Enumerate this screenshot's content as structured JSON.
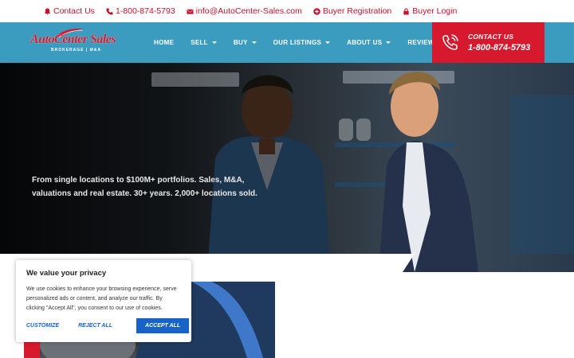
{
  "topbar": {
    "contact_label": "Contact Us",
    "phone": "1-800-874-5793",
    "email": "info@AutoCenter-Sales.com",
    "registration_label": "Buyer Registration",
    "login_label": "Buyer Login"
  },
  "logo": {
    "name": "AutoCenter Sales",
    "sub": "BROKERAGE | M&A"
  },
  "nav": {
    "items": [
      {
        "label": "HOME",
        "dropdown": false
      },
      {
        "label": "SELL",
        "dropdown": true
      },
      {
        "label": "BUY",
        "dropdown": true
      },
      {
        "label": "OUR LISTINGS",
        "dropdown": true
      },
      {
        "label": "ABOUT US",
        "dropdown": true
      },
      {
        "label": "REVIEWS",
        "dropdown": false
      }
    ]
  },
  "contact_box": {
    "title": "CONTACT US",
    "phone": "1-800-874-5793"
  },
  "hero": {
    "tagline": "From single locations to $100M+ portfolios. Sales, M&A, valuations and real estate. 30+ years. 2,000+ locations sold."
  },
  "cookie": {
    "title": "We value your privacy",
    "body": "We use cookies to enhance your browsing experience, serve personalized ads or content, and analyze our traffic. By clicking \"Accept All\", you consent to our use of cookies.",
    "customize_label": "CUSTOMIZE",
    "reject_label": "REJECT ALL",
    "accept_label": "ACCEPT ALL"
  },
  "colors": {
    "brand_red": "#d7192e",
    "nav_blue": "#3b9cc0",
    "link_blue": "#1863c8"
  }
}
